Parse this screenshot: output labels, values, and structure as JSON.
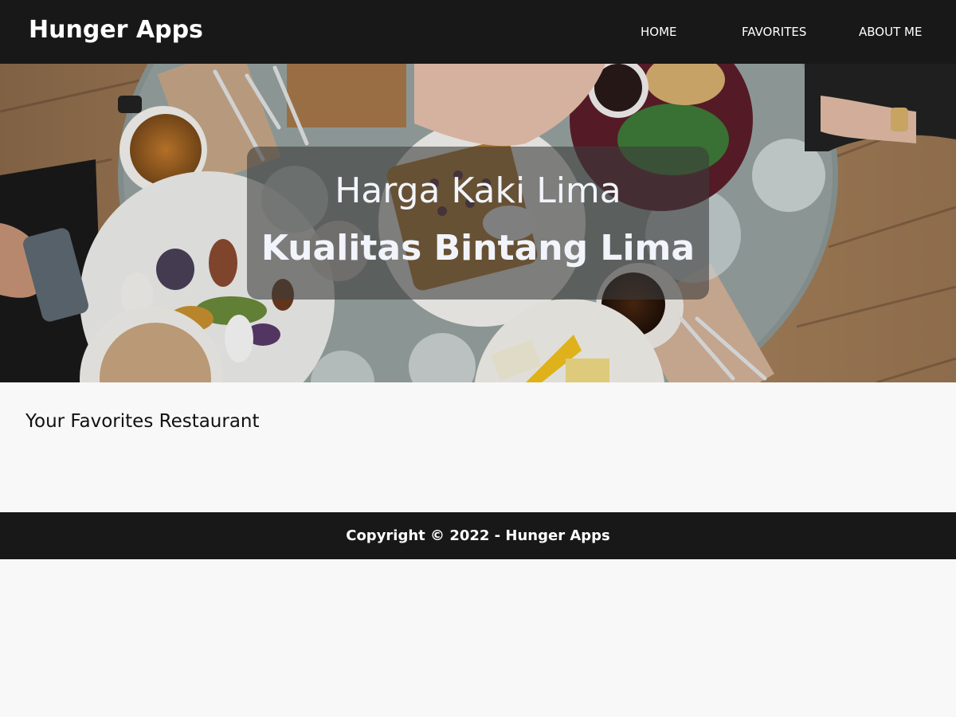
{
  "header": {
    "brand": "Hunger Apps",
    "nav": [
      {
        "label": "HOME"
      },
      {
        "label": "FAVORITES"
      },
      {
        "label": "ABOUT ME"
      }
    ]
  },
  "hero": {
    "tagline": "Harga Kaki Lima",
    "title": "Kualitas Bintang Lima"
  },
  "main": {
    "heading": "Your Favorites Restaurant"
  },
  "footer": {
    "copyright": "Copyright © 2022 - Hunger Apps"
  },
  "colors": {
    "bar": "#181818",
    "background": "#f8f8f8",
    "hero_text": "#f2f4fb"
  }
}
